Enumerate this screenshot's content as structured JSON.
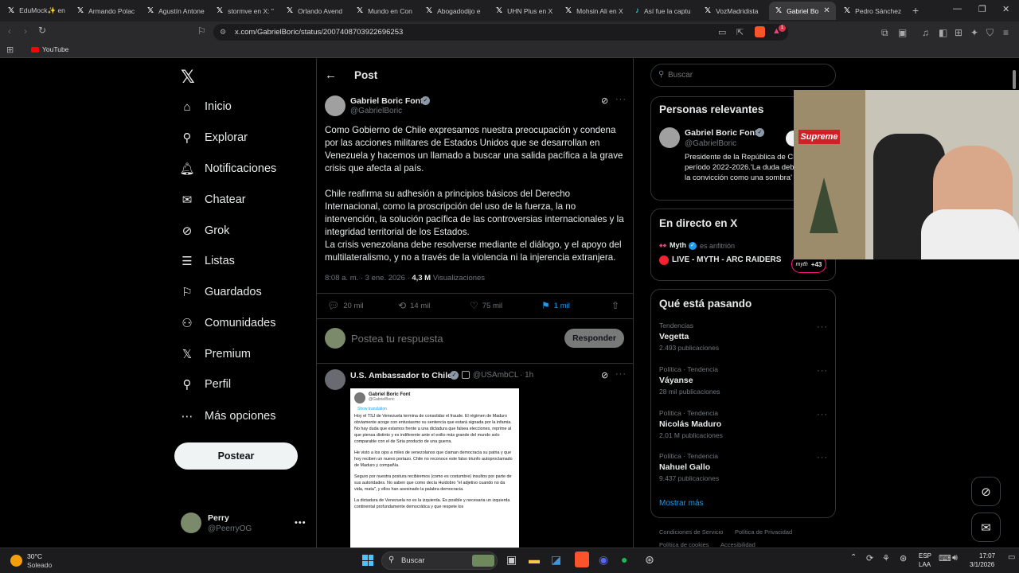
{
  "browser": {
    "tabs": [
      {
        "label": "EduMock✨ en",
        "icon": "x-logo"
      },
      {
        "label": "Armando Polac",
        "icon": "x-logo"
      },
      {
        "label": "Agustín Antone",
        "icon": "x-logo"
      },
      {
        "label": "stormve en X: \"",
        "icon": "x-logo"
      },
      {
        "label": "Orlando Avend",
        "icon": "x-logo"
      },
      {
        "label": "Mundo en Con",
        "icon": "x-logo"
      },
      {
        "label": "Abogadodijo e",
        "icon": "x-logo"
      },
      {
        "label": "UHN Plus en X",
        "icon": "x-logo"
      },
      {
        "label": "Mohsin Ali en X",
        "icon": "x-logo"
      },
      {
        "label": "Así fue la captu",
        "icon": "tiktok"
      },
      {
        "label": "VozMadridista",
        "icon": "x-logo"
      },
      {
        "label": "Gabriel Bo",
        "icon": "x-logo",
        "active": true
      },
      {
        "label": "Pedro Sánchez",
        "icon": "x-logo"
      }
    ],
    "url": "x.com/GabrielBoric/status/2007408703922696253",
    "bookmark": "YouTube",
    "shield_badge": "1"
  },
  "nav": {
    "items": [
      {
        "label": "Inicio",
        "icon": "home-icon"
      },
      {
        "label": "Explorar",
        "icon": "search-icon"
      },
      {
        "label": "Notificaciones",
        "icon": "bell-icon"
      },
      {
        "label": "Chatear",
        "icon": "mail-icon"
      },
      {
        "label": "Grok",
        "icon": "grok-icon"
      },
      {
        "label": "Listas",
        "icon": "list-icon"
      },
      {
        "label": "Guardados",
        "icon": "bookmark-icon"
      },
      {
        "label": "Comunidades",
        "icon": "communities-icon"
      },
      {
        "label": "Premium",
        "icon": "x-logo-icon"
      },
      {
        "label": "Perfil",
        "icon": "person-icon"
      },
      {
        "label": "Más opciones",
        "icon": "more-circle-icon"
      }
    ],
    "post_button": "Postear",
    "account": {
      "name": "Perry",
      "handle": "@PeerryOG"
    }
  },
  "main": {
    "header": "Post",
    "tweet": {
      "author": "Gabriel Boric Font",
      "handle": "@GabrielBoric",
      "paragraphs": [
        "Como Gobierno de Chile expresamos nuestra preocupación y condena por las acciones militares de Estados Unidos que se desarrollan en Venezuela y hacemos un llamado a buscar una salida pacífica a la grave crisis que afecta al país.",
        "Chile reafirma su adhesión a principios básicos del Derecho Internacional, como la proscripción del uso de la fuerza, la no intervención, la solución pacífica de las controversias internacionales y la integridad territorial de los Estados.",
        "La crisis venezolana debe resolverse mediante el diálogo, y el apoyo del multilateralismo, y no a través de la violencia ni la injerencia extranjera."
      ],
      "time": "8:08 a. m. · 3 ene. 2026 · ",
      "views_count": "4,3 M",
      "views_label": " Visualizaciones",
      "replies": "20 mil",
      "reposts": "14 mil",
      "likes": "75 mil",
      "bookmarks": "1 mil"
    },
    "reply_placeholder": "Postea tu respuesta",
    "reply_button": "Responder",
    "reply": {
      "author": "U.S. Ambassador to Chile",
      "handle": "@USAmbCL",
      "time": "· 1h",
      "embedded": {
        "author": "Gabriel Boric Font",
        "handle": "@GabrielBoric",
        "show_translation": "Show translation",
        "paragraphs": [
          "Hoy el TSJ de Venezuela termina de consolidar el fraude. El régimen de Maduro obviamente acoge con entusiasmo su sentencia que estará signada por la infamia. No hay duda que estamos frente a una dictadura que falsea elecciones, reprime al que piensa distinto y es indiferente ante el exilio más grande del mundo solo comparable con el de Siria producto de una guerra.",
          "He visto a los ojos a miles de venezolanos que claman democracia su patria y que hoy reciben un nuevo portazo. Chile no reconoce este falso triunfo autoproclamado de Maduro y compañía.",
          "Seguro por nuestra postura recibiremos (como es costumbre) insultos por parte de sus autoridades. No saben que como decía Huidobro \"el adjetivo cuando no da vida, mata\", y ellos han asesinado la palabra democracia.",
          "La dictadura de Venezuela no es la izquierda. Es posible y necesaria un izquierda continental profundamente democrática y que respete los"
        ]
      }
    }
  },
  "right": {
    "search_placeholder": "Buscar",
    "relevant": {
      "title": "Personas relevantes",
      "name": "Gabriel Boric Font",
      "handle": "@GabrielBoric",
      "bio": "Presidente de la República de Chile período 2022-2026.'La duda debe seguir a la convicción como una sombra' A. Camus"
    },
    "live": {
      "title": "En directo en X",
      "host": "Myth",
      "host_role": "es anfitrión",
      "stream": "LIVE - MYTH - ARC RAIDERS",
      "extra": "+43",
      "extra_tag": "myth"
    },
    "trending": {
      "title": "Qué está pasando",
      "items": [
        {
          "category": "Tendencias",
          "name": "Vegetta",
          "count": "2.493 publicaciones"
        },
        {
          "category": "Política · Tendencia",
          "name": "Váyanse",
          "count": "28 mil publicaciones"
        },
        {
          "category": "Política · Tendencia",
          "name": "Nicolás Maduro",
          "count": "2,01 M publicaciones"
        },
        {
          "category": "Política · Tendencia",
          "name": "Nahuel Gallo",
          "count": "9.437 publicaciones"
        }
      ],
      "more": "Mostrar más"
    },
    "footer": [
      "Condiciones de Servicio",
      "Política de Privacidad",
      "Política de cookies",
      "Accesibilidad"
    ]
  },
  "webcam": {
    "poster_text": "Supreme"
  },
  "taskbar": {
    "weather_temp": "30°C",
    "weather_desc": "Soleado",
    "search": "Buscar",
    "lang": "ESP",
    "lang2": "LAA",
    "time": "17:07",
    "date": "3/1/2026"
  }
}
